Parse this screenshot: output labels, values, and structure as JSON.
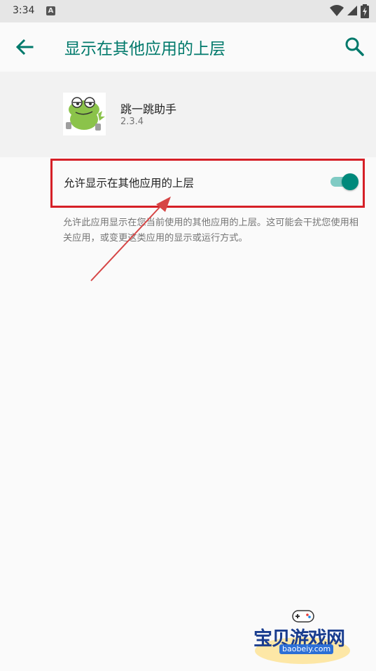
{
  "status_bar": {
    "time": "3:34",
    "notification_glyph": "A",
    "icons": [
      "wifi-icon",
      "signal-icon",
      "battery-charging-icon"
    ]
  },
  "app_bar": {
    "title": "显示在其他应用的上层",
    "back_icon": "arrow-back-icon",
    "search_icon": "search-icon"
  },
  "app_info": {
    "name": "跳一跳助手",
    "version": "2.3.4",
    "icon": "frog-app-icon"
  },
  "permission": {
    "label": "允许显示在其他应用的上层",
    "enabled": true,
    "summary": "允许此应用显示在您当前使用的其他应用的上层。这可能会干扰您使用相关应用，或变更这类应用的显示或运行方式。"
  },
  "watermark": {
    "text": "宝贝游戏网",
    "url": "baobeiy.com"
  },
  "colors": {
    "accent": "#00796b",
    "switch_thumb": "#00897b",
    "switch_track": "#80cbc4",
    "highlight_box": "#d62027"
  }
}
